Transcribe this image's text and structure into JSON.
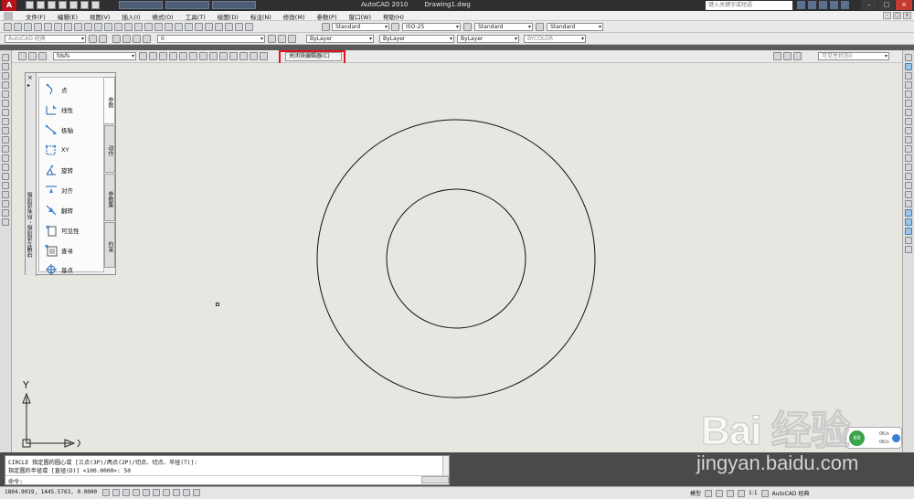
{
  "title_bar": {
    "app_name": "AutoCAD 2010",
    "document": "Drawing1.dwg",
    "search_placeholder": "键入关键字或短语",
    "window_controls": [
      "minimize-icon",
      "maximize-icon",
      "close-icon"
    ]
  },
  "menu": {
    "items": [
      "文件(F)",
      "编辑(E)",
      "视图(V)",
      "插入(I)",
      "格式(O)",
      "工具(T)",
      "绘图(D)",
      "标注(N)",
      "修改(M)",
      "参数(P)",
      "窗口(W)",
      "帮助(H)"
    ]
  },
  "toolbar1": {
    "text_style": "Standard",
    "dim_style": "ISO-25",
    "table_style": "Standard",
    "multileader_style": "Standard"
  },
  "toolbar2": {
    "workspace": "AutoCAD 经典",
    "layer": "0",
    "color": "ByLayer",
    "linetype": "ByLayer",
    "lineweight": "ByLayer",
    "plotstyle": "BYCOLOR"
  },
  "block_editor": {
    "block_name": "fdsfs",
    "close_button": "关闭块编辑器(C)",
    "visibility_state": "可见性状态0"
  },
  "palette": {
    "vertical_title": "块编写选项板 - 所有选项板",
    "items": [
      "点",
      "线性",
      "极轴",
      "XY",
      "旋转",
      "对齐",
      "翻转",
      "可见性",
      "查寻",
      "基点"
    ],
    "tabs": [
      "参数",
      "动作",
      "参数集",
      "约束"
    ]
  },
  "drawing": {
    "ucs_x": "X",
    "ucs_y": "Y",
    "outer_circle_radius": 100,
    "inner_circle_radius": 50
  },
  "command": {
    "history_1": "CIRCLE 指定圆的圆心或 [三点(3P)/两点(2P)/切点、切点、半径(T)]:",
    "history_2": "指定圆的半径或 [直径(D)] <100.0000>: 50",
    "prompt": "命令:"
  },
  "status": {
    "coordinates": "1804.9019, 1445.5763, 0.0000",
    "model": "模型",
    "scale": "1:1",
    "workspace": "AutoCAD 经典"
  },
  "net_widget": {
    "badge": "69",
    "upload": "0K/s",
    "download": "0K/s"
  },
  "watermark": {
    "brand": "Bai 经验",
    "url": "jingyan.baidu.com"
  },
  "colors": {
    "canvas": "#e8e6e1",
    "highlight": "#e0141a",
    "title_bar": "#2f2f31"
  }
}
